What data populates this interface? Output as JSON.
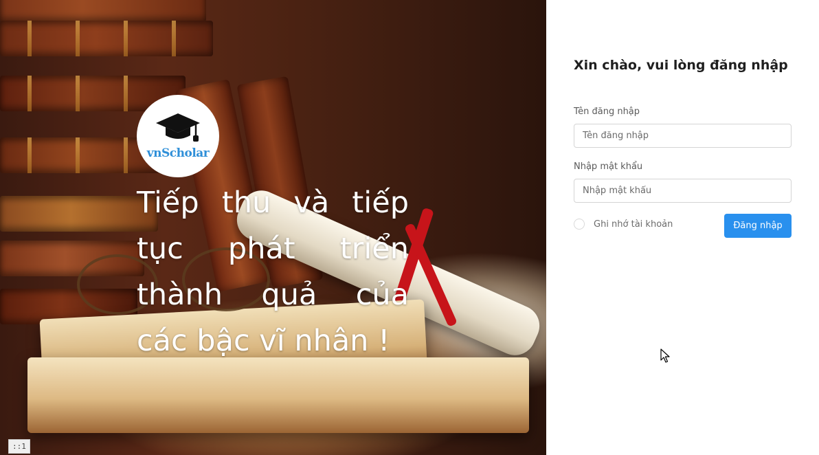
{
  "hero": {
    "logo_text": "vnScholar",
    "logo_icon": "graduation-cap-icon",
    "tagline": "Tiếp thu và tiếp tục phát triển thành quả của các bậc vĩ nhân !",
    "corner_badge": "::1"
  },
  "login": {
    "title": "Xin chào, vui lòng đăng nhập",
    "username": {
      "label": "Tên đăng nhập",
      "placeholder": "Tên đăng nhập",
      "value": ""
    },
    "password": {
      "label": "Nhập mật khẩu",
      "placeholder": "Nhập mật khẩu",
      "value": ""
    },
    "remember_label": "Ghi nhớ tài khoản",
    "remember_checked": false,
    "submit_label": "Đăng nhập"
  },
  "colors": {
    "accent": "#2990ee",
    "logo_text": "#2f8fd8"
  }
}
